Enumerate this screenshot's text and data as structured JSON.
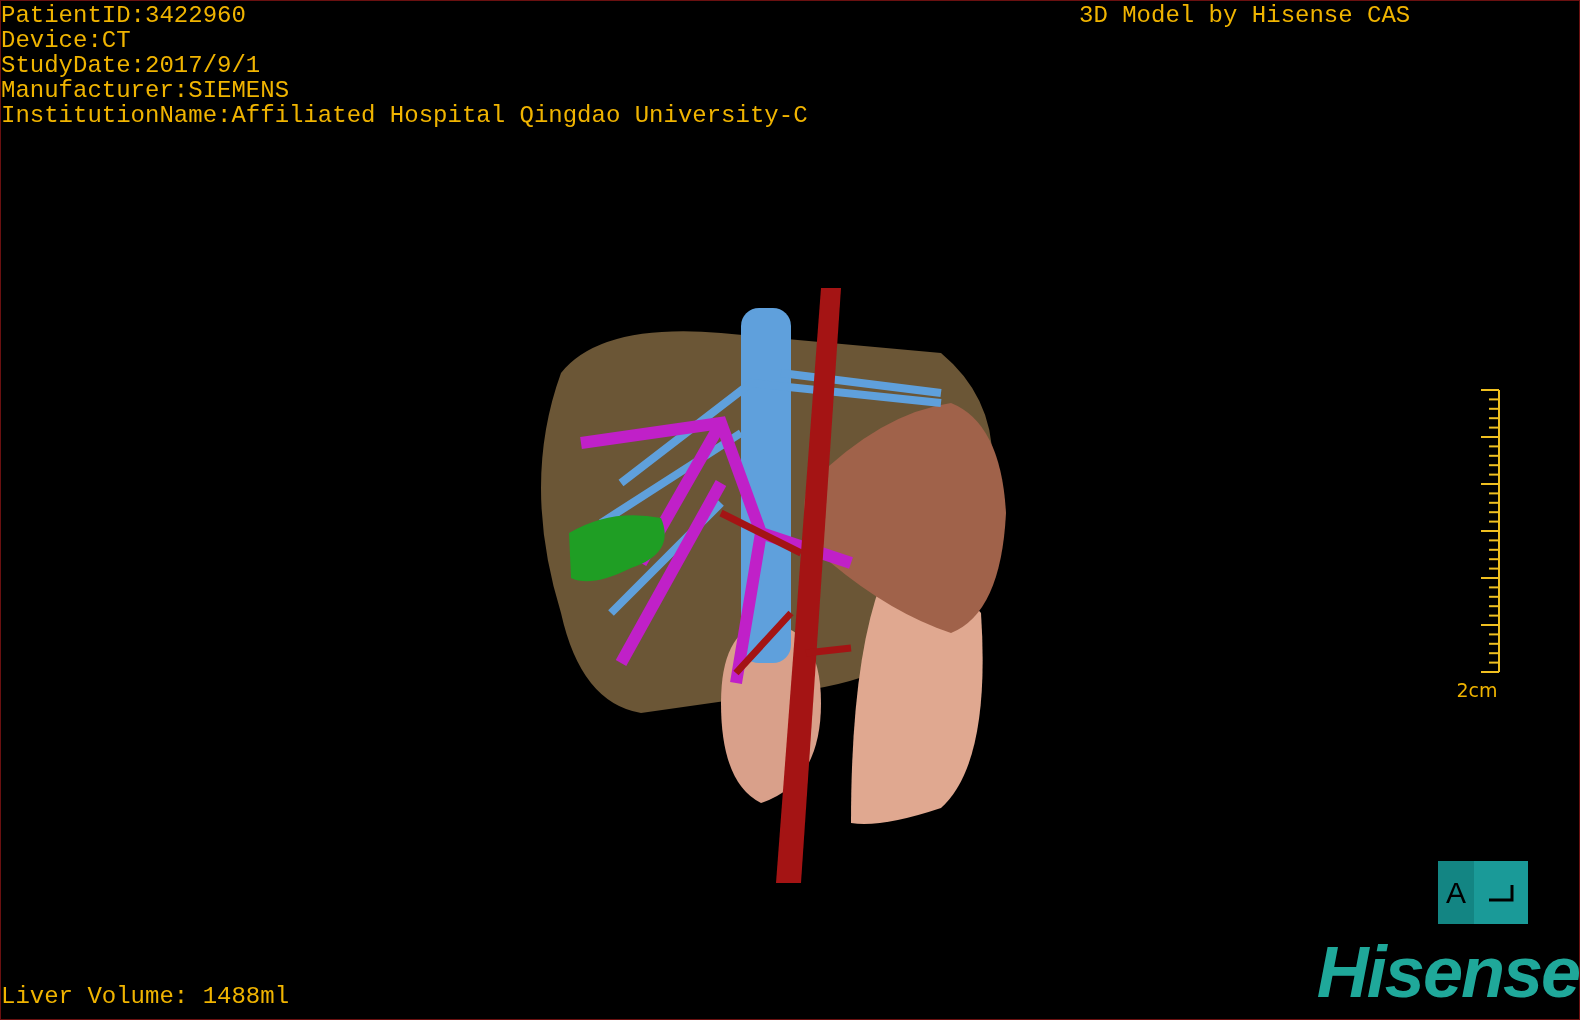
{
  "info_lines": [
    "PatientID:3422960",
    "Device:CT",
    "StudyDate:2017/9/1",
    "Manufacturer:SIEMENS",
    "InstitutionName:Affiliated Hospital Qingdao University-C"
  ],
  "title": "3D Model by Hisense CAS",
  "scale": {
    "label": "2cm"
  },
  "orientation_cube": {
    "label": "A"
  },
  "liver_volume": "Liver Volume: 1488ml",
  "logo": "Hisense"
}
